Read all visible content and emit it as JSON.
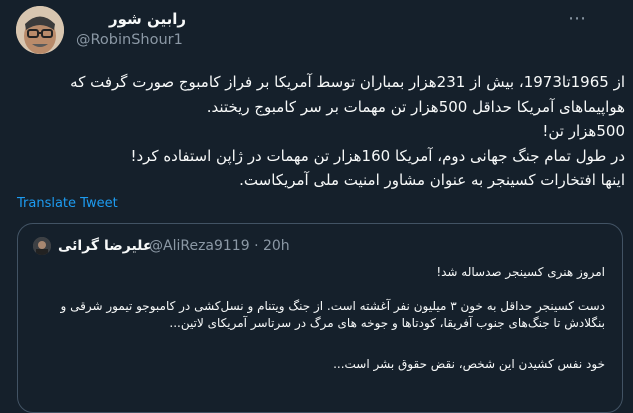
{
  "tweet": {
    "author_name": "رابین شور",
    "author_handle": "@RobinShour1",
    "more_icon": "more-dots",
    "body_lines": [
      "از 1965تا1973، بیش از 231هزار بمباران توسط آمریکا بر فراز کامبوج صورت گرفت که",
      "هواپیماهای آمریکا حداقل 500هزار تن مهمات بر سر کامبوج ریختند.",
      "500هزار تن!",
      "در طول تمام جنگ جهانی دوم، آمریکا 160هزار تن مهمات در ژاپن استفاده کرد!",
      "اینها افتخارات کسینجر به عنوان مشاور امنیت ملی آمریکاست."
    ],
    "translate_label": "Translate Tweet"
  },
  "quote": {
    "name": "علیرضا گرائی",
    "handle_time": "@AliReza9119 · 20h",
    "lines": [
      "امروز هنری کسینجر صدساله شد!",
      "دست کسینجر حداقل به خون ۳ میلیون نفر آغشته است. از جنگ ویتنام و نسل‌کشی در کامبوجو تیمور شرقی و",
      "بنگلادش تا جنگ‌های جنوب آفریقا، کودتاها و جوخه های مرگ در سرتاسر آمریکای لاتین...",
      "خود نفس کشیدن این شخص، نقض حقوق بشر است..."
    ]
  }
}
